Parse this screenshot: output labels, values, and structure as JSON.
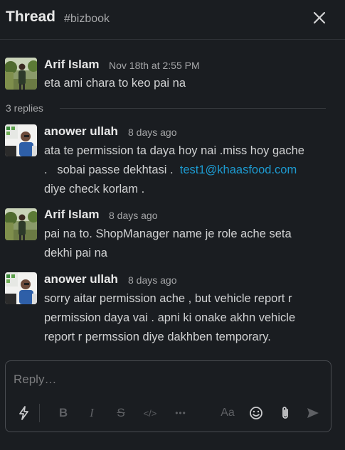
{
  "header": {
    "title": "Thread",
    "channel": "#bizbook",
    "close_icon": "close-icon"
  },
  "parent": {
    "author": "Arif Islam",
    "time": "Nov 18th at 2:55 PM",
    "text": "eta ami chara to keo pai na"
  },
  "replies_label": "3 replies",
  "replies": [
    {
      "author": "anower ullah",
      "time": "8 days ago",
      "line1": "ata te permission ta daya hoy nai .miss hoy gache",
      "line2_pre": ".   sobai passe dekhtasi .  ",
      "line2_link": "test1@khaasfood.com",
      "line3": "diye check korlam ."
    },
    {
      "author": "Arif Islam",
      "time": "8 days ago",
      "line1": "pai na to. ShopManager name je role ache seta",
      "line2": "dekhi pai na"
    },
    {
      "author": "anower ullah",
      "time": "8 days ago",
      "line1": "sorry aitar permission ache , but vehicle report r",
      "line2": "permission daya vai .  apni ki onake akhn vehicle",
      "line3": "report r permssion diye dakhben temporary."
    }
  ],
  "composer": {
    "placeholder": "Reply…",
    "toolbar": {
      "shortcuts": "shortcuts-lightning-icon",
      "bold": "B",
      "italic": "I",
      "strike": "S",
      "code": "</>",
      "more": "•••",
      "format": "Aa",
      "emoji": "emoji-icon",
      "attach": "paperclip-icon",
      "send": "send-icon"
    }
  },
  "colors": {
    "background": "#1a1d21",
    "link": "#1d9bd1",
    "text": "#d1d2d3",
    "muted": "#a6a7a9"
  }
}
